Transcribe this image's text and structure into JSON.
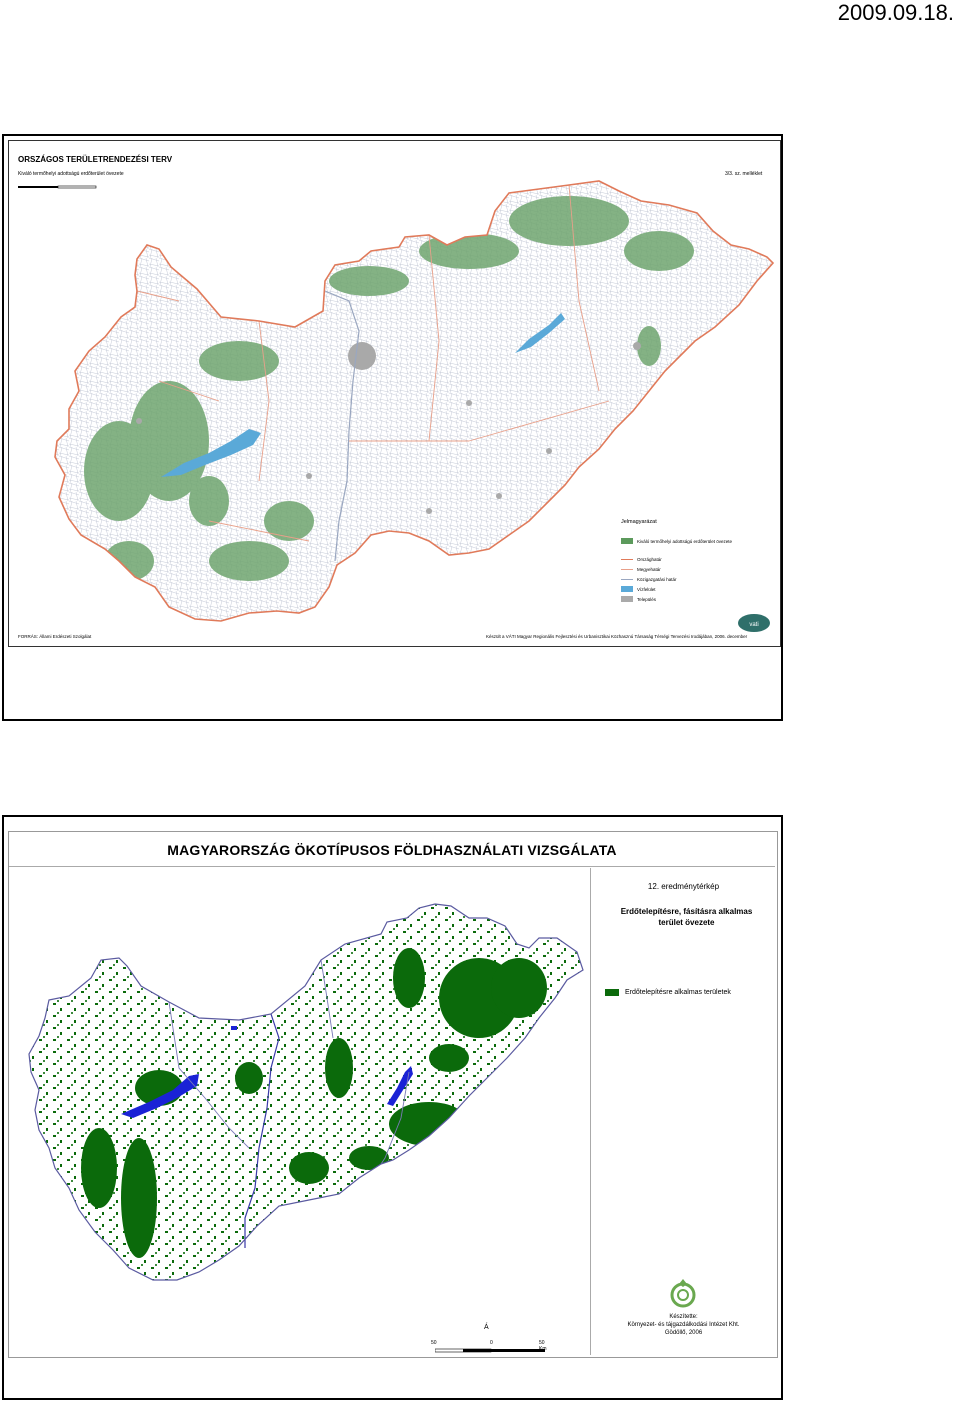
{
  "header": {
    "date": "2009.09.18."
  },
  "map1": {
    "title": "ORSZÁGOS TERÜLETRENDEZÉSI TERV",
    "subtitle": "Kiváló termőhelyi adottságú erdőterület övezete",
    "annex": "3/3. sz. melléklet",
    "legend": {
      "title": "Jelmagyarázat",
      "items": [
        {
          "label": "Kiváló termőhelyi adottságú erdőterület övezete",
          "color": "#5c9a5c",
          "kind": "fill"
        },
        {
          "label": "Országhatár",
          "color": "#e07a5a",
          "kind": "line"
        },
        {
          "label": "Megyehatár",
          "color": "#e8a08a",
          "kind": "line"
        },
        {
          "label": "Közigazgatási határ",
          "color": "#9aa7c0",
          "kind": "line"
        },
        {
          "label": "Vízfelület",
          "color": "#5aa9d8",
          "kind": "fill"
        },
        {
          "label": "Település",
          "color": "#aaaaaa",
          "kind": "fill"
        }
      ]
    },
    "source": "FORRÁS: Állami Erdészeti Szolgálat",
    "made_by": "Készült a VÁTI Magyar Regionális Fejlesztési és Urbanisztikai Közhasznú Társaság Térségi Tervezési Irodájában, 2006. december",
    "colors": {
      "border": "#e07a5a",
      "forest": "#5c9a5c",
      "water": "#5aa9d8",
      "admin": "#c8ccd8"
    }
  },
  "map2": {
    "title": "MAGYARORSZÁG ÖKOTÍPUSOS FÖLDHASZNÁLATI VIZSGÁLATA",
    "map_number": "12. eredménytérkép",
    "theme_line1": "Erdőtelepítésre, fásításra alkalmas",
    "theme_line2": "terület övezete",
    "legend_label": "Erdőtelepítésre alkalmas területek",
    "north": "Á",
    "scale": {
      "left": "50",
      "mid": "0",
      "right": "50 Km"
    },
    "prepared_by": "Készítette:",
    "institute": "Környezet- és tájgazdálkodási Intézet Kht.",
    "place_year": "Gödöllő, 2006",
    "colors": {
      "forest": "#0b6a0b",
      "water": "#1a22d6",
      "river": "#3a3aa8"
    }
  }
}
